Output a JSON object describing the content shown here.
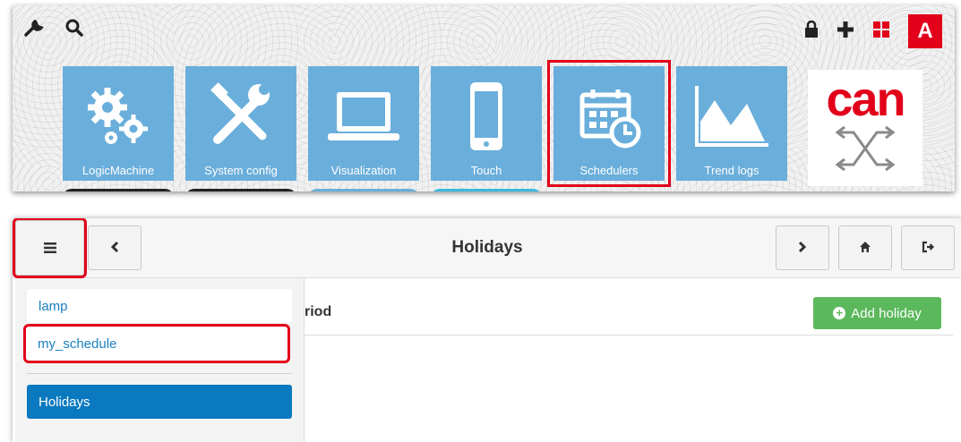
{
  "launcher": {
    "tiles": [
      {
        "label": "LogicMachine",
        "icon": "gears-icon"
      },
      {
        "label": "System config",
        "icon": "tools-icon"
      },
      {
        "label": "Visualization",
        "icon": "laptop-icon"
      },
      {
        "label": "Touch",
        "icon": "phone-icon"
      },
      {
        "label": "Schedulers",
        "icon": "calendar-clock-icon"
      },
      {
        "label": "Trend logs",
        "icon": "area-chart-icon"
      }
    ],
    "logo_text": "can",
    "avatar_letter": "A",
    "colors": {
      "tile": "#6aaedb",
      "accent": "#e2001a"
    }
  },
  "holidays": {
    "title": "Holidays",
    "sidebar": {
      "items": [
        "lamp",
        "my_schedule",
        "Holidays"
      ]
    },
    "column_header": "riod",
    "add_button": "Add holiday",
    "colors": {
      "active": "#0b79bf",
      "add": "#5cb85c"
    }
  }
}
